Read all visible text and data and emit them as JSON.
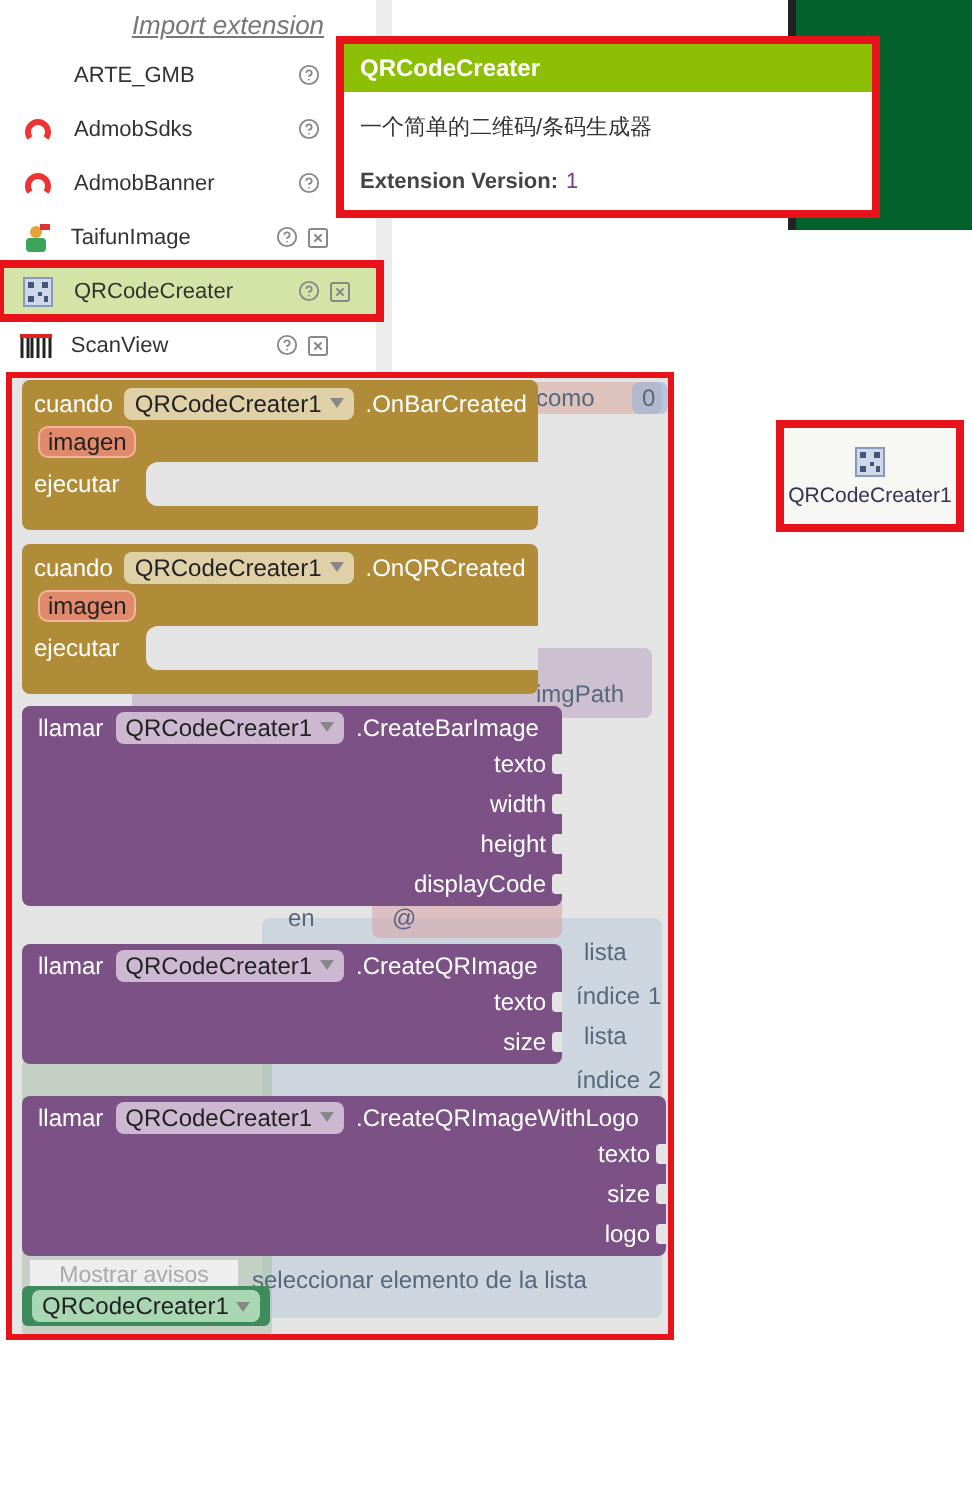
{
  "sidebar": {
    "import_link": "Import extension",
    "items": [
      {
        "name": "ARTE_GMB",
        "kind": "blank",
        "deletable": false,
        "selected": false
      },
      {
        "name": "AdmobSdks",
        "kind": "ring",
        "deletable": false,
        "selected": false
      },
      {
        "name": "AdmobBanner",
        "kind": "ring",
        "deletable": false,
        "selected": false
      },
      {
        "name": "TaifunImage",
        "kind": "figure",
        "deletable": true,
        "selected": false
      },
      {
        "name": "QRCodeCreater",
        "kind": "qr",
        "deletable": true,
        "selected": true
      },
      {
        "name": "ScanView",
        "kind": "scan",
        "deletable": true,
        "selected": false
      }
    ]
  },
  "tooltip": {
    "title": "QRCodeCreater",
    "description": "一个简单的二维码/条码生成器",
    "version_label": "Extension Version:",
    "version": "1"
  },
  "workspace": {
    "background_texts": [
      "como",
      "0",
      "imgPath",
      "en",
      "@",
      "lista",
      "índice",
      "1",
      "lista",
      "índice",
      "2",
      "seleccionar elemento de la lista"
    ],
    "warnings_button": "Mostrar avisos",
    "blocks": [
      {
        "kind": "event",
        "keyword": "cuando",
        "component": "QRCodeCreater1",
        "member": ".OnBarCreated",
        "param": "imagen",
        "do_label": "ejecutar"
      },
      {
        "kind": "event",
        "keyword": "cuando",
        "component": "QRCodeCreater1",
        "member": ".OnQRCreated",
        "param": "imagen",
        "do_label": "ejecutar"
      },
      {
        "kind": "method",
        "keyword": "llamar",
        "component": "QRCodeCreater1",
        "member": ".CreateBarImage",
        "args": [
          "texto",
          "width",
          "height",
          "displayCode"
        ]
      },
      {
        "kind": "method",
        "keyword": "llamar",
        "component": "QRCodeCreater1",
        "member": ".CreateQRImage",
        "args": [
          "texto",
          "size"
        ]
      },
      {
        "kind": "method",
        "keyword": "llamar",
        "component": "QRCodeCreater1",
        "member": ".CreateQRImageWithLogo",
        "args": [
          "texto",
          "size",
          "logo"
        ]
      },
      {
        "kind": "component",
        "component": "QRCodeCreater1"
      }
    ]
  },
  "component": {
    "name": "QRCodeCreater1"
  }
}
